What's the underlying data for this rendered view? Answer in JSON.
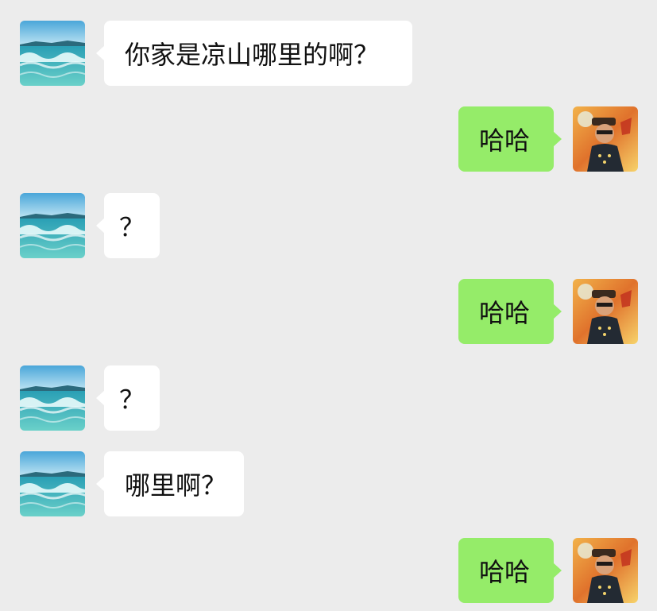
{
  "messages": [
    {
      "from": "contact",
      "text": "你家是凉山哪里的啊？",
      "avatar": "sea-waves-avatar"
    },
    {
      "from": "me",
      "text": "哈哈",
      "avatar": "cartoon-character-avatar"
    },
    {
      "from": "contact",
      "text": "？",
      "avatar": "sea-waves-avatar"
    },
    {
      "from": "me",
      "text": "哈哈",
      "avatar": "cartoon-character-avatar"
    },
    {
      "from": "contact",
      "text": "？",
      "avatar": "sea-waves-avatar"
    },
    {
      "from": "contact",
      "text": "哪里啊？",
      "avatar": "sea-waves-avatar"
    },
    {
      "from": "me",
      "text": "哈哈",
      "avatar": "cartoon-character-avatar"
    }
  ],
  "colors": {
    "background": "#ececec",
    "incoming_bubble": "#ffffff",
    "outgoing_bubble": "#95ec69",
    "text": "#111111"
  }
}
